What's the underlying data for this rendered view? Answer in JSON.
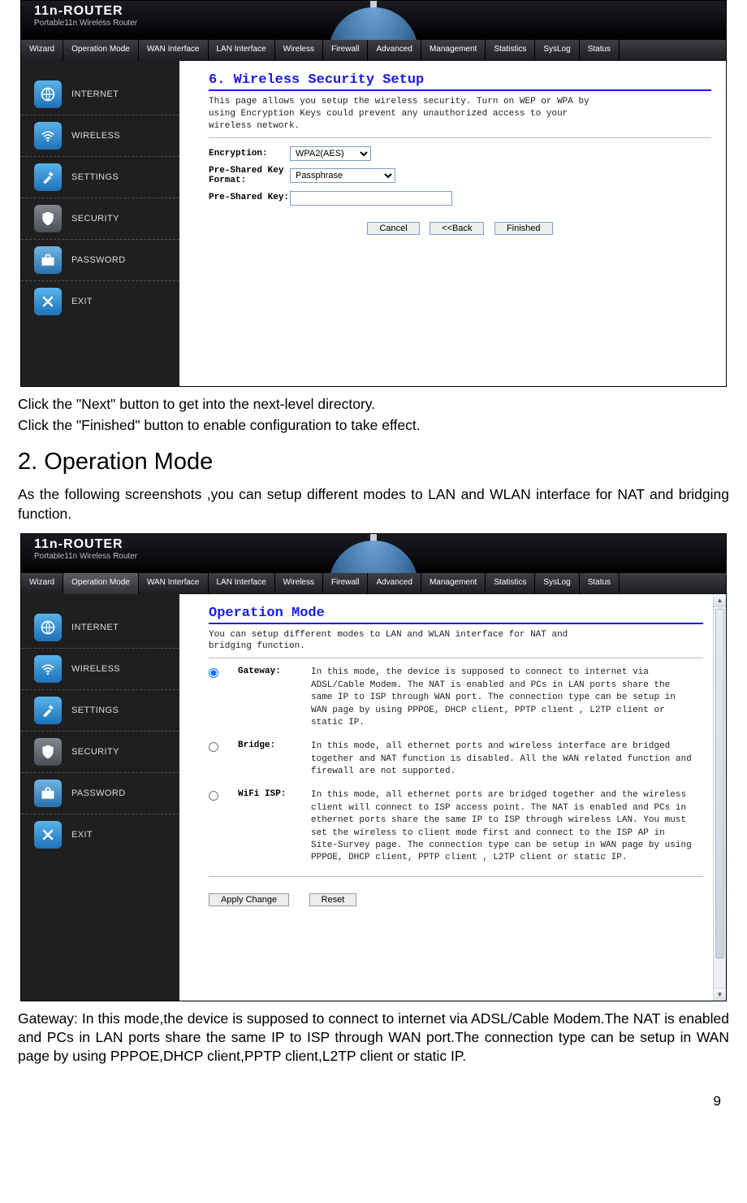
{
  "logo": {
    "line1": "11n-ROUTER",
    "line2": "Portable11n Wireless Router"
  },
  "tabs": [
    "Wizard",
    "Operation Mode",
    "WAN Interface",
    "LAN Interface",
    "Wireless",
    "Firewall",
    "Advanced",
    "Management",
    "Statistics",
    "SysLog",
    "Status"
  ],
  "side": [
    "INTERNET",
    "WIRELESS",
    "SETTINGS",
    "SECURITY",
    "PASSWORD",
    "EXIT"
  ],
  "shot1": {
    "title": "6. Wireless Security Setup",
    "desc": "This page allows you setup the wireless security. Turn on WEP or WPA by using Encryption Keys could prevent any unauthorized access to your wireless network.",
    "enc_label": "Encryption:",
    "enc_value": "WPA2(AES)",
    "psk_format_label": "Pre-Shared Key Format:",
    "psk_format_value": "Passphrase",
    "psk_label": "Pre-Shared Key:",
    "psk_value": "",
    "btn_cancel": "Cancel",
    "btn_back": "<<Back",
    "btn_finish": "Finished"
  },
  "doc": {
    "p1": "Click the \"Next\" button to get into the next-level directory.",
    "p2": "Click the \"Finished\" button to enable configuration to take effect.",
    "h1": "2. Operation Mode",
    "p3": "As the following screenshots ,you can setup different modes to LAN and WLAN interface for NAT and bridging function.",
    "p4": "Gateway: In this mode,the device is supposed to connect to internet via ADSL/Cable Modem.The NAT is enabled and PCs in LAN ports share the same IP to ISP through WAN port.The connection type can be setup in WAN page by using PPPOE,DHCP client,PPTP client,L2TP client or static IP.",
    "pagenum": "9"
  },
  "shot2": {
    "active_tab": 1,
    "title": "Operation Mode",
    "desc": "You can setup different modes to LAN and WLAN interface for NAT and bridging function.",
    "modes": [
      {
        "name": "Gateway:",
        "desc": "In this mode, the device is supposed to connect to internet via ADSL/Cable Modem. The NAT is enabled and PCs in LAN ports share the same IP to ISP through WAN port. The connection type can be setup in WAN page by using PPPOE, DHCP client, PPTP client , L2TP client or static IP.",
        "checked": true
      },
      {
        "name": "Bridge:",
        "desc": "In this mode, all ethernet ports and wireless interface are bridged together and NAT function is disabled. All the WAN related function and firewall are not supported.",
        "checked": false
      },
      {
        "name": "WiFi ISP:",
        "desc": "In this mode, all ethernet ports are bridged together and the wireless client will connect to ISP access point. The NAT is enabled and PCs in ethernet ports share the same IP to ISP through wireless LAN. You must set the wireless to client mode first and connect to the ISP AP in Site-Survey page. The connection type can be setup in WAN page by using PPPOE, DHCP client, PPTP client , L2TP client or static IP.",
        "checked": false
      }
    ],
    "btn_apply": "Apply Change",
    "btn_reset": "Reset"
  }
}
